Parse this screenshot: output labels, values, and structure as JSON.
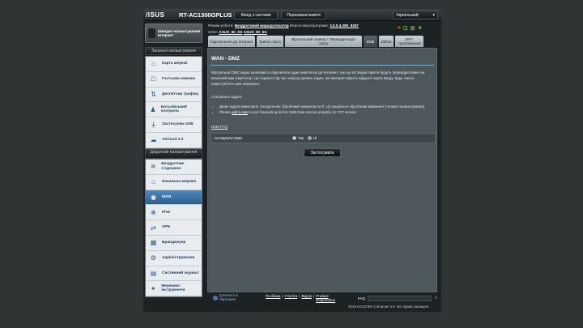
{
  "header": {
    "logo": "/ISUS",
    "model": "RT-AC1300GPLUS",
    "logout": "Вихід з системи",
    "reboot": "Перезавантажити",
    "language": "Український",
    "language_arrow": "▾"
  },
  "status": {
    "mode_label": "Режим роботи:",
    "mode_value": "Бездротовий маршрутизатор",
    "fw_label": "Версія мікропрограми:",
    "fw_value": "3.0.0.4.380_8457",
    "ssid_label": "SSID:",
    "ssid1": "ASUS_60_2G",
    "ssid2": "ASUS_60_5G"
  },
  "sidebar": {
    "quick_setup": "Швидке налаштування Інтернет",
    "general_header": "Загальні налаштування",
    "general_items": [
      {
        "label": "Карта мережі",
        "icon": "⌂"
      },
      {
        "label": "Гостьова мережа",
        "icon": "☖"
      },
      {
        "label": "Диспетчер трафіку",
        "icon": "⇅"
      },
      {
        "label": "Батьківський контроль",
        "icon": "♟"
      },
      {
        "label": "Застосунки USB",
        "icon": "⏚"
      },
      {
        "label": "AiCloud 2.0",
        "icon": "☁"
      }
    ],
    "advanced_header": "Додаткові налаштування",
    "advanced_items": [
      {
        "label": "Бездротове з`єднання",
        "icon": "≋"
      },
      {
        "label": "Локальна мережа",
        "icon": "⌂"
      },
      {
        "label": "WAN",
        "icon": "◉"
      },
      {
        "label": "IPv6",
        "icon": "⊕"
      },
      {
        "label": "VPN",
        "icon": "⇄"
      },
      {
        "label": "Брандмауер",
        "icon": "▦"
      },
      {
        "label": "Адміністрування",
        "icon": "⚙"
      },
      {
        "label": "Системний журнал",
        "icon": "▤"
      },
      {
        "label": "Мережеві інструменти",
        "icon": "✦"
      }
    ]
  },
  "tabs": [
    {
      "label": "Підключення до Інтернет"
    },
    {
      "label": "Тригер порту"
    },
    {
      "label": "Віртуальний сервер / Переадресація порту"
    },
    {
      "label": "DMZ"
    },
    {
      "label": "DDNS"
    },
    {
      "label": "NAT-тунелювання"
    }
  ],
  "content": {
    "title": "WAN - DMZ",
    "description": "Віртуальна DMZ надає можливість підключати один комп'ютер до Інтернет, так що всі вхідні пакети будуть переадресовані на вказаний вам комп'ютер. Це корисно під час запуску деяких задач, які використовують відкриті порти вводу. Будь ласка, користуйтеся цим обережно.",
    "special_label": "Спеціальні задачі:",
    "note1": "Деякі задачі вимагають спеціальних обробників миканізм NAT. Ці спеціальні обробники ввімкнені (типове налаштування).",
    "note2_pre": "Please ",
    "note2_link": "add a rule",
    "note2_post": " to port forwarding list for USB Disk access properly on FTP service",
    "faq_link": "DMZ FAQ",
    "enable_label": "Активувати DMZ",
    "yes": "Так",
    "no": "Ні",
    "apply": "Застосувати"
  },
  "footer": {
    "help": "Допомога & Підтримка",
    "links": [
      "Посібник",
      "Утиліти",
      "Відгук",
      "Product Registration"
    ],
    "faq": "FAQ",
    "copyright": "2019 ASUSTeK Computer Inc. Всі права захищені."
  }
}
